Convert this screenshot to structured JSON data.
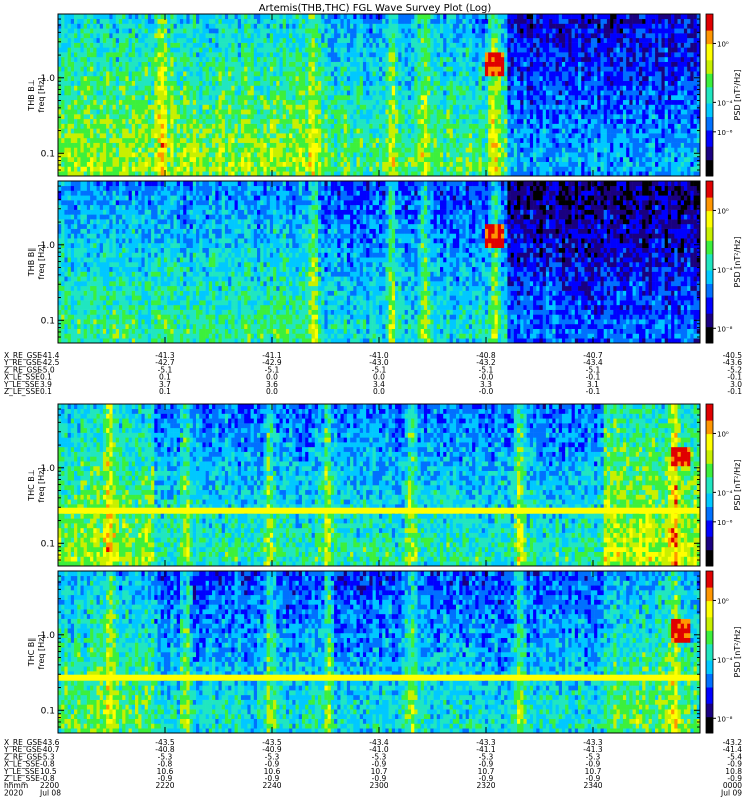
{
  "title": "Artemis(THB,THC) FGL Wave Survey Plot (Log)",
  "colors": {
    "colormap": [
      "#000000",
      "#1a0080",
      "#0000ff",
      "#0070ff",
      "#00c8ff",
      "#20e6c0",
      "#3cf03c",
      "#c8f000",
      "#ffff00",
      "#ff9600",
      "#e00000",
      "#800000"
    ],
    "band": "#ffff00",
    "frame": "#000000"
  },
  "chart_data": [
    {
      "type": "heatmap",
      "id": "thb-bperp",
      "ylabel": "THB B⊥ freq [Hz]",
      "yticks": [
        {
          "v": 0.1,
          "label": "0.1"
        },
        {
          "v": 1.0,
          "label": "1.0"
        }
      ],
      "ylim": [
        0.05,
        7.0
      ],
      "yscale": "log",
      "zlabel": "PSD [nT²/Hz]",
      "zticks": [
        {
          "exp": 0,
          "label": "10⁰"
        },
        {
          "exp": -4,
          "label": "10⁻⁴"
        },
        {
          "exp": -6,
          "label": "10⁻⁶"
        }
      ],
      "zexp_range": [
        -9,
        2
      ],
      "regimes": [
        {
          "from": 0.0,
          "to": 0.4,
          "level": 0.55
        },
        {
          "from": 0.4,
          "to": 0.7,
          "level": 0.48
        },
        {
          "from": 0.7,
          "to": 1.0,
          "level": 0.3
        }
      ],
      "bursts": [
        0.16,
        0.4,
        0.52,
        0.57,
        0.68
      ],
      "band": null,
      "spot": {
        "t": 0.68,
        "f": 1.5
      }
    },
    {
      "type": "heatmap",
      "id": "thb-bpar",
      "ylabel": "THB B∥ freq [Hz]",
      "yticks": [
        {
          "v": 0.1,
          "label": "0.1"
        },
        {
          "v": 1.0,
          "label": "1.0"
        }
      ],
      "ylim": [
        0.05,
        7.0
      ],
      "yscale": "log",
      "zlabel": "PSD [nT²/Hz]",
      "zticks": [
        {
          "exp": 0,
          "label": "10⁰"
        },
        {
          "exp": -4,
          "label": "10⁻⁴"
        },
        {
          "exp": -8,
          "label": "10⁻⁸"
        }
      ],
      "zexp_range": [
        -9,
        2
      ],
      "regimes": [
        {
          "from": 0.0,
          "to": 0.4,
          "level": 0.45
        },
        {
          "from": 0.4,
          "to": 0.7,
          "level": 0.38
        },
        {
          "from": 0.7,
          "to": 1.0,
          "level": 0.22
        }
      ],
      "bursts": [
        0.4,
        0.52,
        0.57,
        0.68
      ],
      "band": null,
      "spot": {
        "t": 0.68,
        "f": 1.3
      }
    },
    {
      "type": "heatmap",
      "id": "thc-bperp",
      "ylabel": "THC B⊥ freq [Hz]",
      "yticks": [
        {
          "v": 0.1,
          "label": "0.1"
        },
        {
          "v": 1.0,
          "label": "1.0"
        }
      ],
      "ylim": [
        0.05,
        7.0
      ],
      "yscale": "log",
      "zlabel": "PSD [nT²/Hz]",
      "zticks": [
        {
          "exp": 0,
          "label": "10⁰"
        },
        {
          "exp": -4,
          "label": "10⁻⁴"
        },
        {
          "exp": -6,
          "label": "10⁻⁶"
        }
      ],
      "zexp_range": [
        -9,
        2
      ],
      "regimes": [
        {
          "from": 0.0,
          "to": 0.15,
          "level": 0.55
        },
        {
          "from": 0.15,
          "to": 0.85,
          "level": 0.42
        },
        {
          "from": 0.85,
          "to": 1.0,
          "level": 0.6
        }
      ],
      "bursts": [
        0.08,
        0.2,
        0.33,
        0.42,
        0.55,
        0.72,
        0.96
      ],
      "band": {
        "f": 0.27
      },
      "spot": {
        "t": 0.97,
        "f": 1.4
      }
    },
    {
      "type": "heatmap",
      "id": "thc-bpar",
      "ylabel": "THC B∥ freq [Hz]",
      "yticks": [
        {
          "v": 0.1,
          "label": "0.1"
        },
        {
          "v": 1.0,
          "label": "1.0"
        }
      ],
      "ylim": [
        0.05,
        7.0
      ],
      "yscale": "log",
      "zlabel": "PSD [nT²/Hz]",
      "zticks": [
        {
          "exp": 0,
          "label": "10⁰"
        },
        {
          "exp": -4,
          "label": "10⁻⁴"
        },
        {
          "exp": -8,
          "label": "10⁻⁸"
        }
      ],
      "zexp_range": [
        -9,
        2
      ],
      "regimes": [
        {
          "from": 0.0,
          "to": 0.15,
          "level": 0.5
        },
        {
          "from": 0.15,
          "to": 0.85,
          "level": 0.38
        },
        {
          "from": 0.85,
          "to": 1.0,
          "level": 0.5
        }
      ],
      "bursts": [
        0.08,
        0.2,
        0.33,
        0.42,
        0.55,
        0.72,
        0.96
      ],
      "band": {
        "f": 0.27
      },
      "spot": {
        "t": 0.97,
        "f": 1.2
      }
    }
  ],
  "ephem_thb": {
    "labels": [
      "X_RE_GSE",
      "Y_RE_GSE",
      "Z_RE_GSE",
      "X_LE_SSE",
      "Y_LE_SSE",
      "Z_LE_SSE"
    ],
    "columns": [
      [
        "-41.4",
        "-42.5",
        "-5.0",
        "0.1",
        "3.9",
        "0.1"
      ],
      [
        "-41.3",
        "-42.7",
        "-5.1",
        "0.1",
        "3.7",
        "0.1"
      ],
      [
        "-41.1",
        "-42.9",
        "-5.1",
        "0.0",
        "3.6",
        "0.0"
      ],
      [
        "-41.0",
        "-43.0",
        "-5.1",
        "0.0",
        "3.4",
        "0.0"
      ],
      [
        "-40.8",
        "-43.2",
        "-5.1",
        "-0.0",
        "3.3",
        "-0.0"
      ],
      [
        "-40.7",
        "-43.4",
        "-5.1",
        "-0.1",
        "3.1",
        "-0.1"
      ],
      [
        "-40.5",
        "-43.6",
        "-5.2",
        "-0.1",
        "3.0",
        "-0.1"
      ]
    ]
  },
  "ephem_thc": {
    "labels": [
      "X_RE_GSE",
      "Y_RE_GSE",
      "Z_RE_GSE",
      "X_LE_SSE",
      "Y_LE_SSE",
      "Z_LE_SSE",
      "hhmm",
      "2020"
    ],
    "columns": [
      [
        "-43.6",
        "-40.7",
        "-5.3",
        "-0.8",
        "10.5",
        "-0.8",
        "2200",
        "Jul 08"
      ],
      [
        "-43.5",
        "-40.8",
        "-5.3",
        "-0.8",
        "10.6",
        "-0.9",
        "2220",
        ""
      ],
      [
        "-43.5",
        "-40.9",
        "-5.3",
        "-0.9",
        "10.6",
        "-0.9",
        "2240",
        ""
      ],
      [
        "-43.4",
        "-41.0",
        "-5.3",
        "-0.9",
        "10.7",
        "-0.9",
        "2300",
        ""
      ],
      [
        "-43.3",
        "-41.1",
        "-5.3",
        "-0.9",
        "10.7",
        "-0.9",
        "2320",
        ""
      ],
      [
        "-43.3",
        "-41.3",
        "-5.3",
        "-0.9",
        "10.7",
        "-0.9",
        "2340",
        ""
      ],
      [
        "-43.2",
        "-41.4",
        "-5.4",
        "-0.9",
        "10.8",
        "-0.9",
        "0000",
        "Jul 09"
      ]
    ]
  }
}
